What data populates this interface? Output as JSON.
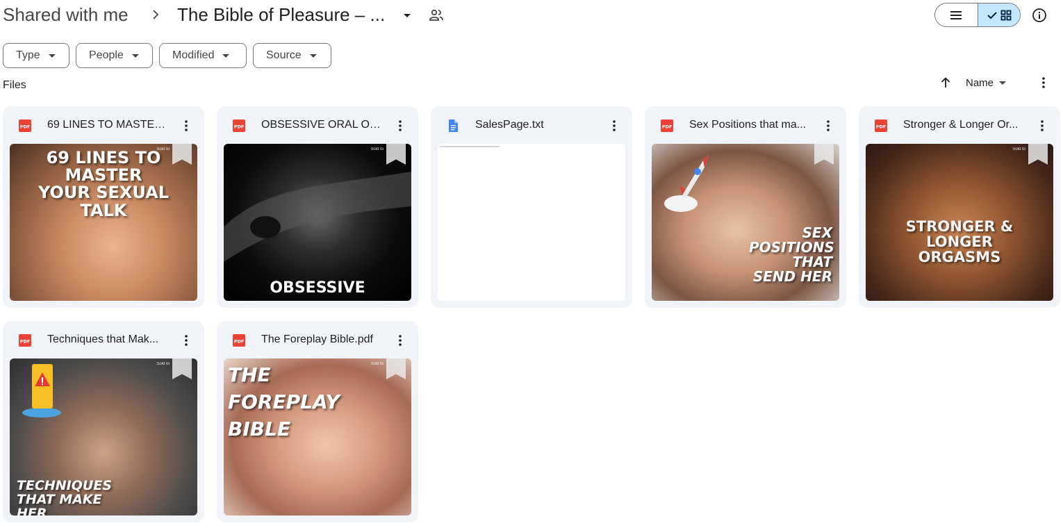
{
  "breadcrumb": {
    "root": "Shared with me",
    "current": "The Bible of Pleasure – ..."
  },
  "filters": [
    {
      "label": "Type"
    },
    {
      "label": "People"
    },
    {
      "label": "Modified"
    },
    {
      "label": "Source"
    }
  ],
  "section": {
    "title": "Files"
  },
  "sort": {
    "label": "Name"
  },
  "files": [
    {
      "name": "69 LINES TO MASTER ...",
      "type": "pdf",
      "thumb_text": "69 LINES TO MASTER YOUR SEXUAL TALK"
    },
    {
      "name": "OBSESSIVE ORAL OR...",
      "type": "pdf",
      "thumb_text": "OBSESSIVE"
    },
    {
      "name": "SalesPage.txt",
      "type": "doc",
      "thumb_text": ""
    },
    {
      "name": "Sex Positions that ma...",
      "type": "pdf",
      "thumb_text": "SEX POSITIONS THAT SEND HER"
    },
    {
      "name": "Stronger & Longer Or...",
      "type": "pdf",
      "thumb_text": "STRONGER & LONGER ORGASMS"
    },
    {
      "name": "Techniques that Mak...",
      "type": "pdf",
      "thumb_text": "TECHNIQUES THAT MAKE HER"
    },
    {
      "name": "The Foreplay Bible.pdf",
      "type": "pdf",
      "thumb_text": "THE FOREPLAY BIBLE"
    }
  ],
  "thumb_watermark": "Sold to",
  "colors": {
    "pdf_red": "#ea4335",
    "doc_blue": "#4285f4",
    "card_bg": "#f0f4f9",
    "selected_view": "#c2e7ff"
  }
}
